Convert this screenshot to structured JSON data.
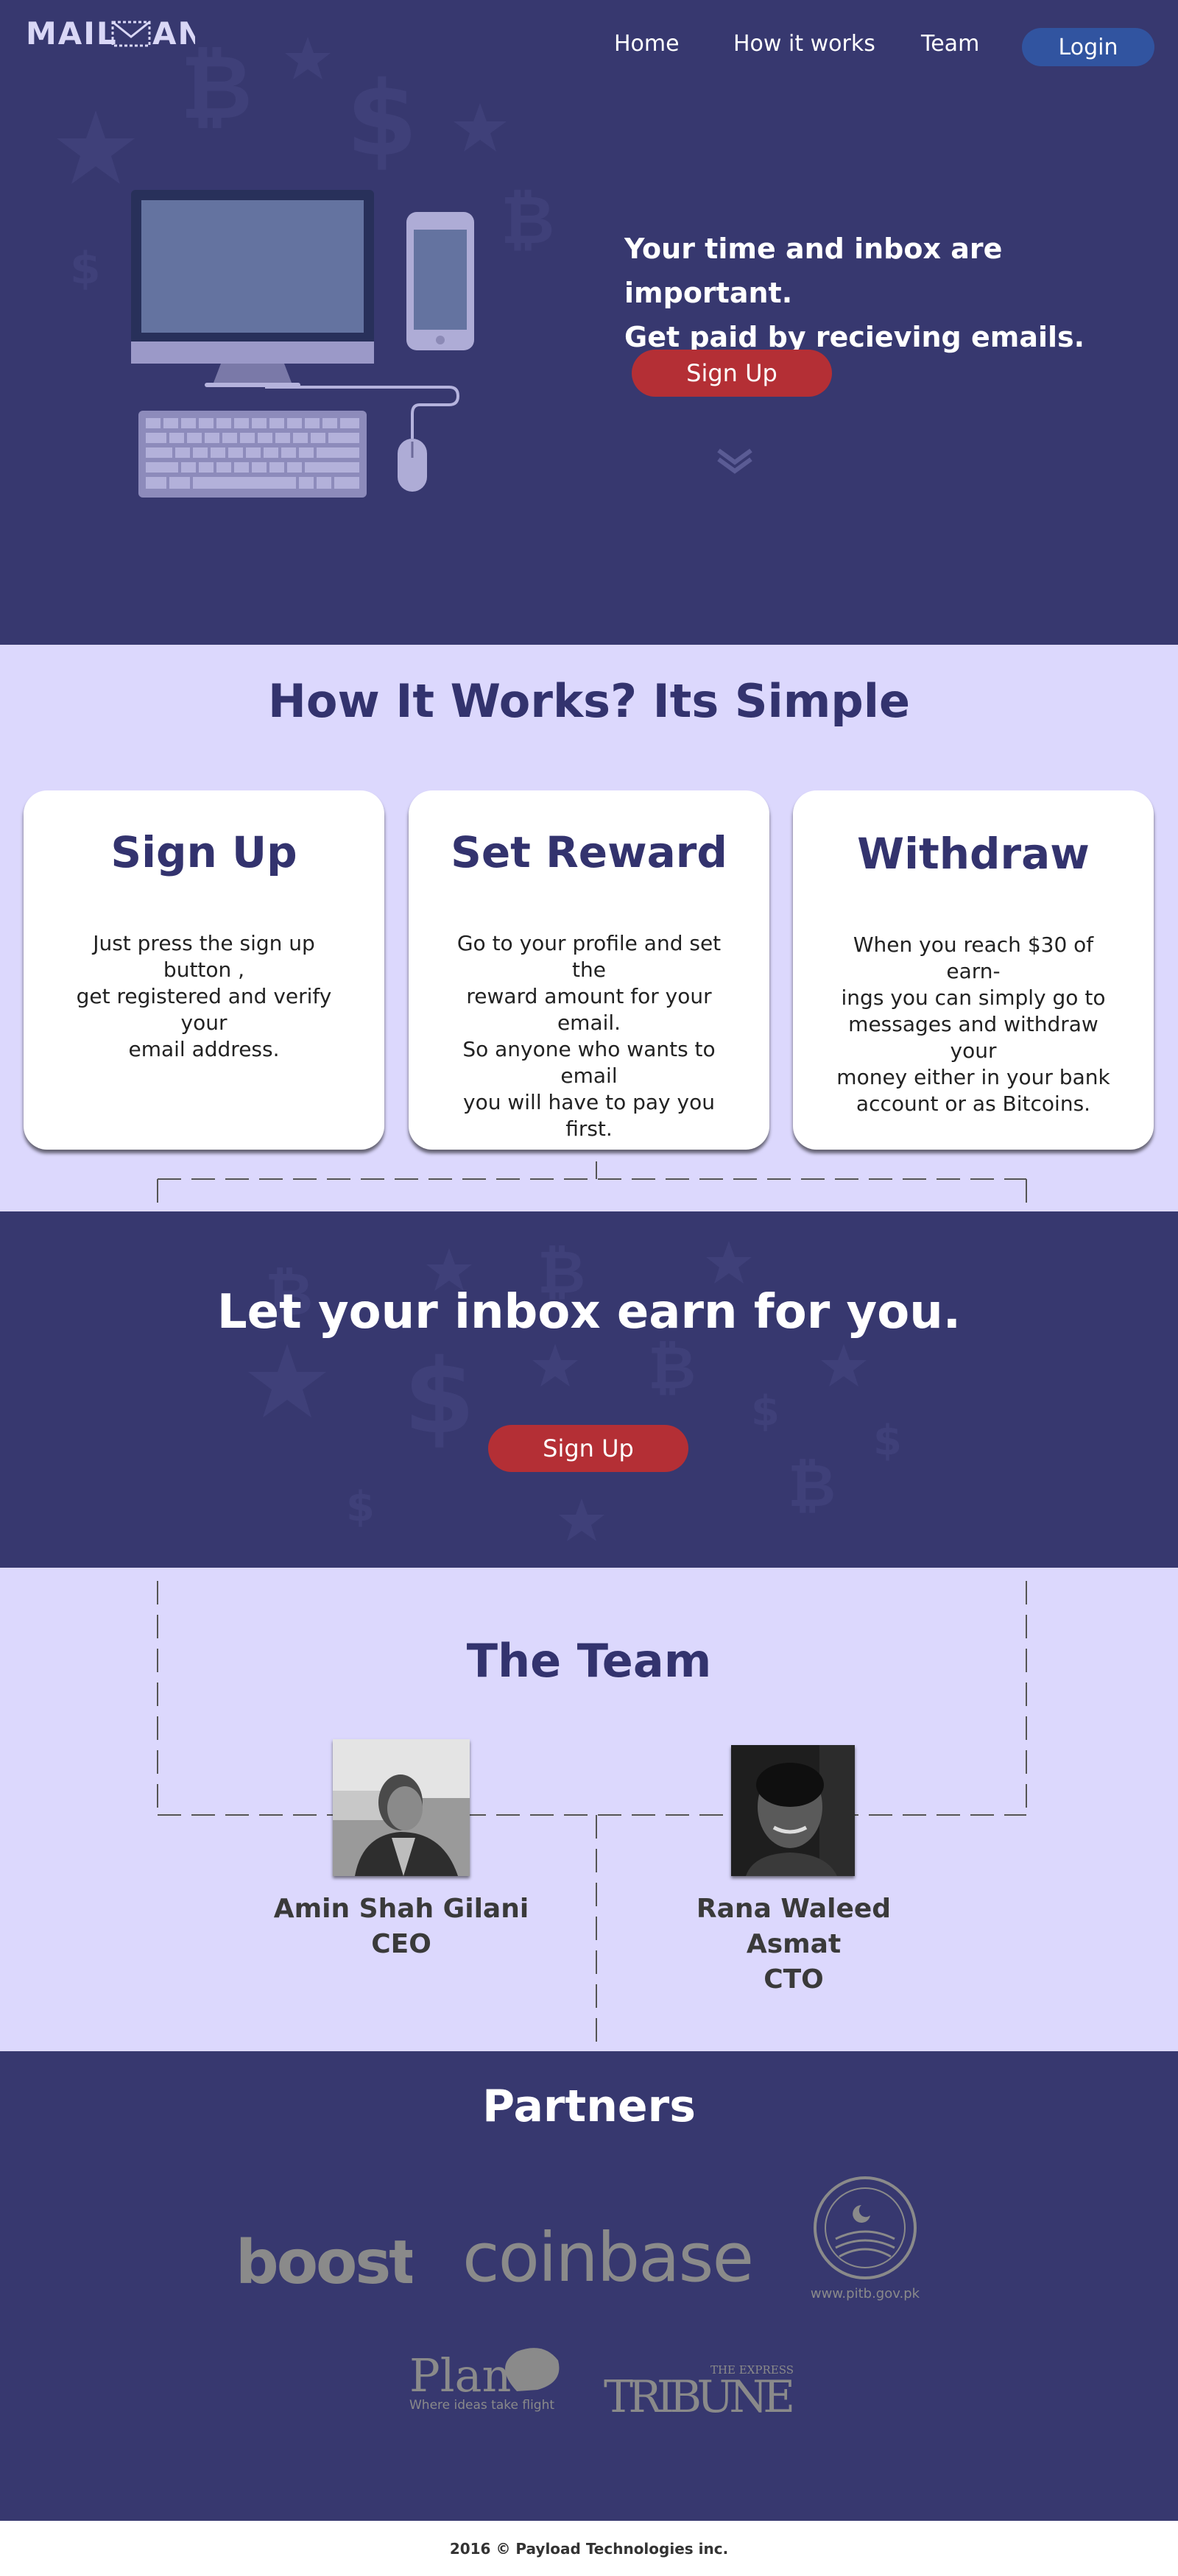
{
  "brand": {
    "logo_text": "MAILMAN"
  },
  "nav": {
    "home": "Home",
    "how_it_works": "How it works",
    "team": "Team",
    "login": "Login"
  },
  "hero": {
    "headline_line1": "Your time and inbox are important.",
    "headline_line2": "Get paid by recieving emails.",
    "signup_label": "Sign Up",
    "scroll_icon": "double-chevron-down-icon"
  },
  "how": {
    "title": "How It Works? Its Simple",
    "cards": [
      {
        "title": "Sign Up",
        "lines": [
          "Just press the sign up button ,",
          "get registered and verify your",
          "email address."
        ]
      },
      {
        "title": "Set Reward",
        "lines": [
          "Go to your profile and set the",
          "reward amount for your email.",
          "So anyone who wants to email",
          "you will have to pay you first."
        ]
      },
      {
        "title": "Withdraw",
        "lines": [
          "When you reach $30 of earn-",
          "ings you can simply go to",
          "messages and withdraw your",
          "money either in your bank",
          "account or as Bitcoins."
        ]
      }
    ]
  },
  "cta": {
    "title": "Let your inbox earn for you.",
    "signup_label": "Sign Up"
  },
  "team": {
    "title": "The Team",
    "members": [
      {
        "name": "Amin Shah Gilani",
        "role": "CEO"
      },
      {
        "name": "Rana Waleed Asmat",
        "role": "CTO"
      }
    ]
  },
  "partners": {
    "title": "Partners",
    "logos": [
      "boost",
      "coinbase",
      "www.pitb.gov.pk",
      "Plan",
      "Where ideas take flight",
      "THE EXPRESS",
      "TRIBUNE"
    ]
  },
  "footer": {
    "copyright": "2016 © Payload Technologies inc."
  },
  "colors": {
    "navy": "#37386f",
    "lavender": "#dcd8fd",
    "red": "#b42f35",
    "login_blue": "#3154a0",
    "title_navy": "#33336e"
  }
}
